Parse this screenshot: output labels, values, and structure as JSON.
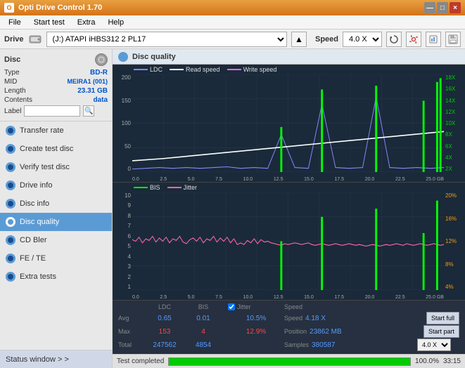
{
  "titleBar": {
    "title": "Opti Drive Control 1.70",
    "controls": [
      "—",
      "□",
      "×"
    ]
  },
  "menuBar": {
    "items": [
      "File",
      "Start test",
      "Extra",
      "Help"
    ]
  },
  "driveBar": {
    "label": "Drive",
    "driveValue": "(J:) ATAPI iHBS312  2 PL17",
    "speedLabel": "Speed",
    "speedValue": "4.0 X"
  },
  "disc": {
    "title": "Disc",
    "type": {
      "label": "Type",
      "value": "BD-R"
    },
    "mid": {
      "label": "MID",
      "value": "MEIRA1 (001)"
    },
    "length": {
      "label": "Length",
      "value": "23.31 GB"
    },
    "contents": {
      "label": "Contents",
      "value": "data"
    },
    "label": {
      "label": "Label"
    }
  },
  "sidebar": {
    "items": [
      {
        "id": "transfer-rate",
        "label": "Transfer rate",
        "active": false
      },
      {
        "id": "create-test-disc",
        "label": "Create test disc",
        "active": false
      },
      {
        "id": "verify-test-disc",
        "label": "Verify test disc",
        "active": false
      },
      {
        "id": "drive-info",
        "label": "Drive info",
        "active": false
      },
      {
        "id": "disc-info",
        "label": "Disc info",
        "active": false
      },
      {
        "id": "disc-quality",
        "label": "Disc quality",
        "active": true
      },
      {
        "id": "cd-bler",
        "label": "CD Bler",
        "active": false
      },
      {
        "id": "fe-te",
        "label": "FE / TE",
        "active": false
      },
      {
        "id": "extra-tests",
        "label": "Extra tests",
        "active": false
      }
    ],
    "statusWindow": "Status window > >"
  },
  "chartHeader": {
    "title": "Disc quality"
  },
  "chart1": {
    "legend": [
      {
        "label": "LDC",
        "color": "#8888ff"
      },
      {
        "label": "Read speed",
        "color": "#ffffff"
      },
      {
        "label": "Write speed",
        "color": "#ff66ff"
      }
    ],
    "yLabels": [
      "200",
      "150",
      "100",
      "50",
      "0"
    ],
    "yLabelsRight": [
      "18X",
      "16X",
      "14X",
      "12X",
      "10X",
      "8X",
      "6X",
      "4X",
      "2X"
    ],
    "xLabels": [
      "0.0",
      "2.5",
      "5.0",
      "7.5",
      "10.0",
      "12.5",
      "15.0",
      "17.5",
      "20.0",
      "22.5",
      "25.0 GB"
    ]
  },
  "chart2": {
    "legend": [
      {
        "label": "BIS",
        "color": "#00ff00"
      },
      {
        "label": "Jitter",
        "color": "#ff66aa"
      }
    ],
    "yLabels": [
      "10",
      "9",
      "8",
      "7",
      "6",
      "5",
      "4",
      "3",
      "2",
      "1"
    ],
    "yLabelsRight": [
      "20%",
      "16%",
      "12%",
      "8%",
      "4%"
    ],
    "xLabels": [
      "0.0",
      "2.5",
      "5.0",
      "7.5",
      "10.0",
      "12.5",
      "15.0",
      "17.5",
      "20.0",
      "22.5",
      "25.0 GB"
    ]
  },
  "stats": {
    "columns": [
      "LDC",
      "BIS",
      "",
      "Jitter",
      "Speed",
      ""
    ],
    "avg": {
      "label": "Avg",
      "ldc": "0.65",
      "bis": "0.01",
      "jitter": "10.5%",
      "speed_label": "Speed",
      "speed": "4.18 X"
    },
    "max": {
      "label": "Max",
      "ldc": "153",
      "bis": "4",
      "jitter": "12.9%",
      "position_label": "Position",
      "position": "23862 MB"
    },
    "total": {
      "label": "Total",
      "ldc": "247562",
      "bis": "4854",
      "samples_label": "Samples",
      "samples": "380587"
    },
    "speedSelect": "4.0 X",
    "startFull": "Start full",
    "startPart": "Start part",
    "jitterChecked": true,
    "jitterLabel": "Jitter"
  },
  "progressBar": {
    "statusText": "Test completed",
    "percent": 100,
    "percentText": "100.0%",
    "time": "33:15"
  }
}
